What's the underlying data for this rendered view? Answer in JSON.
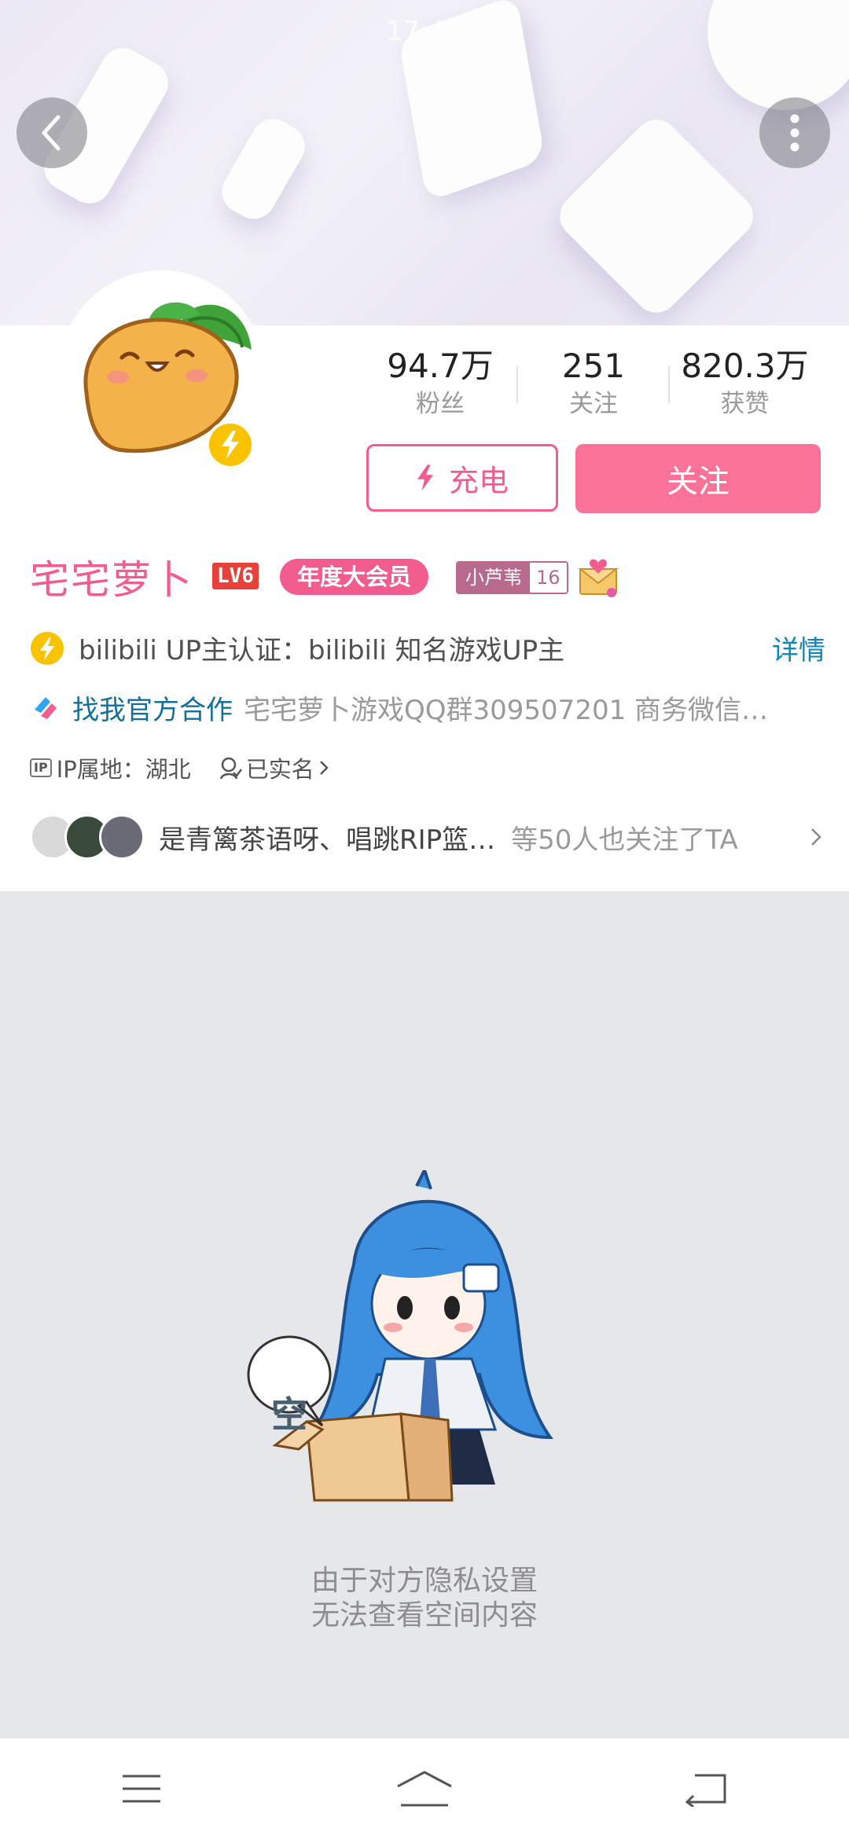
{
  "status_bar": {
    "time": "17:40"
  },
  "profile": {
    "name": "宅宅萝卜",
    "level": "LV6",
    "vip_badge": "年度大会员",
    "fan_badge": {
      "name": "小芦苇",
      "level": "16"
    }
  },
  "stats": [
    {
      "value": "94.7万",
      "label": "粉丝"
    },
    {
      "value": "251",
      "label": "关注"
    },
    {
      "value": "820.3万",
      "label": "获赞"
    }
  ],
  "actions": {
    "charge_label": "充电",
    "follow_label": "关注"
  },
  "certification": {
    "text": "bilibili UP主认证：bilibili 知名游戏UP主",
    "detail_link": "详情"
  },
  "cooperation": {
    "title": "找我官方合作",
    "description": "宅宅萝卜游戏QQ群309507201  商务微信…"
  },
  "meta": {
    "ip_tag": "IP",
    "ip_location": "IP属地：湖北",
    "verified": "已实名"
  },
  "mutual_followers": {
    "names": "是青篱茶语呀、唱跳RIP篮…",
    "suffix": "等50人也关注了TA"
  },
  "empty_state": {
    "bubble_text": "空",
    "line1": "由于对方隐私设置",
    "line2": "无法查看空间内容"
  },
  "colors": {
    "accent_pink": "#fb7299",
    "name_pink": "#f25d8e",
    "link_blue": "#0f86b8",
    "bolt_yellow": "#f9c300"
  }
}
